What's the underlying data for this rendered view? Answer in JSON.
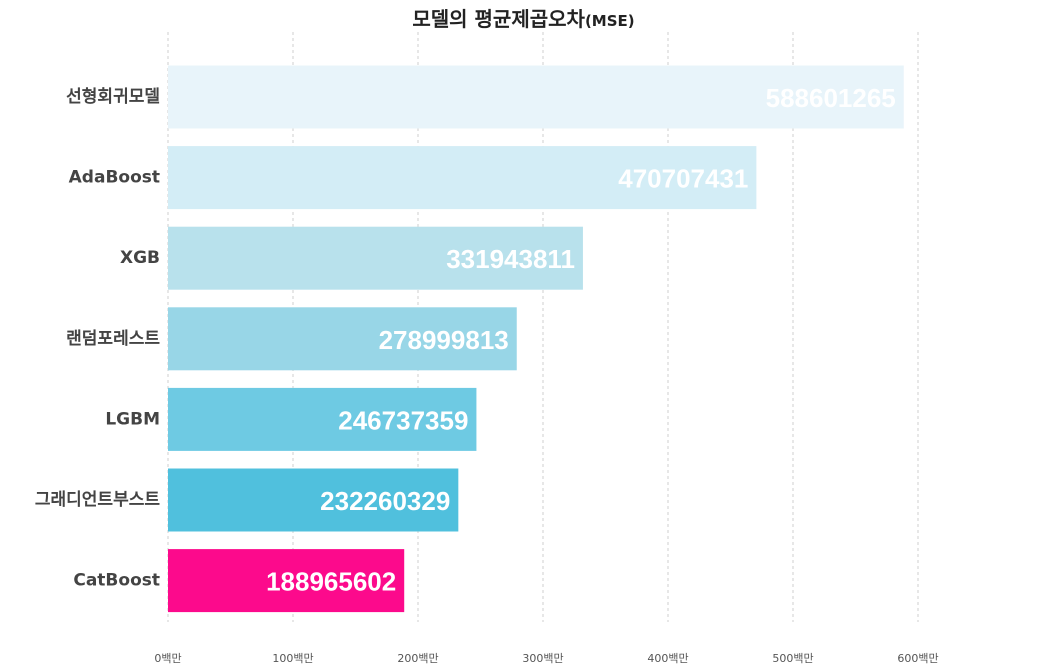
{
  "chart_data": {
    "type": "bar",
    "orientation": "horizontal",
    "title": "모델의 평균제곱오차",
    "title_suffix": "(MSE)",
    "categories": [
      "선형회귀모델",
      "AdaBoost",
      "XGB",
      "랜덤포레스트",
      "LGBM",
      "그래디언트부스트",
      "CatBoost"
    ],
    "values": [
      588601265,
      470707431,
      331943811,
      278999813,
      246737359,
      232260329,
      188965602
    ],
    "value_labels": [
      "588601265",
      "470707431",
      "331943811",
      "278999813",
      "246737359",
      "232260329",
      "188965602"
    ],
    "colors": [
      "#e8f4fa",
      "#d3edf6",
      "#b8e1ec",
      "#98d6e7",
      "#6ecae3",
      "#50c0dd",
      "#fc0a8c"
    ],
    "xlim": [
      0,
      600000000
    ],
    "xticks": [
      0,
      100000000,
      200000000,
      300000000,
      400000000,
      500000000,
      600000000
    ],
    "xtick_labels": [
      "0백만",
      "100백만",
      "200백만",
      "300백만",
      "400백만",
      "500백만",
      "600백만"
    ],
    "grid": "vertical dashed",
    "legend": "none"
  }
}
